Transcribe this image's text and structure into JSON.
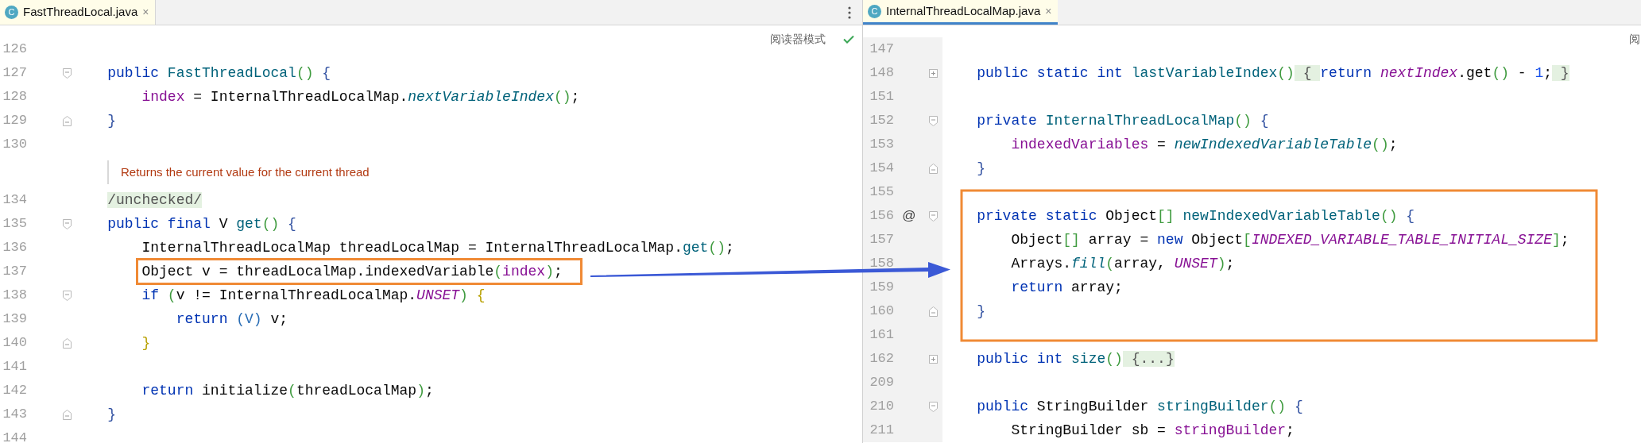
{
  "editors": [
    {
      "tab": {
        "icon_letter": "C",
        "title": "FastThreadLocal.java",
        "close": "×",
        "selected": false
      },
      "reader_mode": "阅读器模式",
      "reader_mode_ok": true,
      "lines": [
        {
          "kind": "code",
          "number": "126"
        },
        {
          "kind": "code",
          "number": "127",
          "expanded": true,
          "segments": [
            {
              "text": "    public ",
              "kind": "kw"
            },
            {
              "text": "FastThreadLocal",
              "kind": "method"
            },
            {
              "text": "()",
              "kind": "paren"
            },
            {
              "text": " {",
              "kind": "brace1"
            }
          ]
        },
        {
          "kind": "code",
          "number": "128",
          "segments": [
            {
              "text": "        index",
              "kind": "field"
            },
            {
              "text": " = InternalThreadLocalMap.",
              "kind": "plain"
            },
            {
              "text": "nextVariableIndex",
              "kind": "smethod"
            },
            {
              "text": "()",
              "kind": "paren"
            },
            {
              "text": ";",
              "kind": "plain"
            }
          ]
        },
        {
          "kind": "code",
          "number": "129",
          "expanded": true,
          "block_end": true,
          "segments": [
            {
              "text": "    }",
              "kind": "brace1"
            }
          ]
        },
        {
          "kind": "code",
          "number": "130"
        },
        {
          "kind": "doc",
          "text": "Returns the current value for the current thread"
        },
        {
          "kind": "code",
          "number": "134",
          "segments": [
            {
              "text": "    /unchecked/",
              "kind": "folded"
            }
          ]
        },
        {
          "kind": "code",
          "number": "135",
          "expanded": true,
          "segments": [
            {
              "text": "    public final ",
              "kind": "kw"
            },
            {
              "text": "V ",
              "kind": "plain"
            },
            {
              "text": "get",
              "kind": "method"
            },
            {
              "text": "()",
              "kind": "paren"
            },
            {
              "text": " {",
              "kind": "brace1"
            }
          ]
        },
        {
          "kind": "code",
          "number": "136",
          "segments": [
            {
              "text": "        InternalThreadLocalMap threadLocalMap = InternalThreadLocalMap.",
              "kind": "plain"
            },
            {
              "text": "get",
              "kind": "method"
            },
            {
              "text": "()",
              "kind": "paren"
            },
            {
              "text": ";",
              "kind": "plain"
            }
          ]
        },
        {
          "kind": "code",
          "number": "137",
          "highlighted": true,
          "segments": [
            {
              "text": "        Object v = threadLocalMap.indexedVariable",
              "kind": "plain"
            },
            {
              "text": "(",
              "kind": "paren"
            },
            {
              "text": "index",
              "kind": "field"
            },
            {
              "text": ")",
              "kind": "paren"
            },
            {
              "text": ";",
              "kind": "plain"
            }
          ]
        },
        {
          "kind": "code",
          "number": "138",
          "expanded": true,
          "segments": [
            {
              "text": "        if ",
              "kind": "kw"
            },
            {
              "text": "(",
              "kind": "paren"
            },
            {
              "text": "v != InternalThreadLocalMap.",
              "kind": "plain"
            },
            {
              "text": "UNSET",
              "kind": "sfield"
            },
            {
              "text": ")",
              "kind": "paren"
            },
            {
              "text": " {",
              "kind": "brace2"
            }
          ]
        },
        {
          "kind": "code",
          "number": "139",
          "segments": [
            {
              "text": "            return ",
              "kind": "kw"
            },
            {
              "text": "(V)",
              "kind": "cast"
            },
            {
              "text": " v;",
              "kind": "plain"
            }
          ]
        },
        {
          "kind": "code",
          "number": "140",
          "expanded": true,
          "block_end": true,
          "segments": [
            {
              "text": "        }",
              "kind": "brace2"
            }
          ]
        },
        {
          "kind": "code",
          "number": "141"
        },
        {
          "kind": "code",
          "number": "142",
          "segments": [
            {
              "text": "        return ",
              "kind": "kw"
            },
            {
              "text": "initialize",
              "kind": "plain"
            },
            {
              "text": "(",
              "kind": "paren"
            },
            {
              "text": "threadLocalMap",
              "kind": "plain"
            },
            {
              "text": ")",
              "kind": "paren"
            },
            {
              "text": ";",
              "kind": "plain"
            }
          ]
        },
        {
          "kind": "code",
          "number": "143",
          "expanded": true,
          "block_end": true,
          "segments": [
            {
              "text": "    }",
              "kind": "brace1"
            }
          ]
        },
        {
          "kind": "code",
          "number": "144"
        }
      ]
    },
    {
      "tab": {
        "icon_letter": "C",
        "title": "InternalThreadLocalMap.java",
        "close": "×",
        "selected": true
      },
      "reader_mode": "阅",
      "lines": [
        {
          "kind": "code",
          "number": "147"
        },
        {
          "kind": "code",
          "number": "148",
          "expanded": false,
          "segments": [
            {
              "text": "    public static int ",
              "kind": "kw"
            },
            {
              "text": "lastVariableIndex",
              "kind": "method"
            },
            {
              "text": "()",
              "kind": "paren"
            },
            {
              "text": " { ",
              "kind": "folded"
            },
            {
              "text": "return ",
              "kind": "kw"
            },
            {
              "text": "nextIndex",
              "kind": "sfield"
            },
            {
              "text": ".get",
              "kind": "plain"
            },
            {
              "text": "()",
              "kind": "paren"
            },
            {
              "text": " - ",
              "kind": "plain"
            },
            {
              "text": "1",
              "kind": "num"
            },
            {
              "text": ";",
              "kind": "plain"
            },
            {
              "text": " }",
              "kind": "folded"
            }
          ]
        },
        {
          "kind": "code",
          "number": "151"
        },
        {
          "kind": "code",
          "number": "152",
          "expanded": true,
          "segments": [
            {
              "text": "    private ",
              "kind": "kw"
            },
            {
              "text": "InternalThreadLocalMap",
              "kind": "method"
            },
            {
              "text": "()",
              "kind": "paren"
            },
            {
              "text": " {",
              "kind": "brace1"
            }
          ]
        },
        {
          "kind": "code",
          "number": "153",
          "segments": [
            {
              "text": "        indexedVariables",
              "kind": "field"
            },
            {
              "text": " = ",
              "kind": "plain"
            },
            {
              "text": "newIndexedVariableTable",
              "kind": "smethod"
            },
            {
              "text": "()",
              "kind": "paren"
            },
            {
              "text": ";",
              "kind": "plain"
            }
          ]
        },
        {
          "kind": "code",
          "number": "154",
          "expanded": true,
          "block_end": true,
          "segments": [
            {
              "text": "    }",
              "kind": "brace1"
            }
          ]
        },
        {
          "kind": "code",
          "number": "155"
        },
        {
          "kind": "code",
          "number": "156",
          "mark": "@",
          "expanded": true,
          "segments": [
            {
              "text": "    private static ",
              "kind": "kw"
            },
            {
              "text": "Object",
              "kind": "plain"
            },
            {
              "text": "[]",
              "kind": "paren"
            },
            {
              "text": " newIndexedVariableTable",
              "kind": "method"
            },
            {
              "text": "()",
              "kind": "paren"
            },
            {
              "text": " {",
              "kind": "brace1"
            }
          ]
        },
        {
          "kind": "code",
          "number": "157",
          "segments": [
            {
              "text": "        Object",
              "kind": "plain"
            },
            {
              "text": "[]",
              "kind": "paren"
            },
            {
              "text": " array = ",
              "kind": "plain"
            },
            {
              "text": "new ",
              "kind": "kw"
            },
            {
              "text": "Object",
              "kind": "plain"
            },
            {
              "text": "[",
              "kind": "paren"
            },
            {
              "text": "INDEXED_VARIABLE_TABLE_INITIAL_SIZE",
              "kind": "sfield"
            },
            {
              "text": "]",
              "kind": "paren"
            },
            {
              "text": ";",
              "kind": "plain"
            }
          ]
        },
        {
          "kind": "code",
          "number": "158",
          "segments": [
            {
              "text": "        Arrays.",
              "kind": "plain"
            },
            {
              "text": "fill",
              "kind": "smethod"
            },
            {
              "text": "(",
              "kind": "paren"
            },
            {
              "text": "array, ",
              "kind": "plain"
            },
            {
              "text": "UNSET",
              "kind": "sfield"
            },
            {
              "text": ")",
              "kind": "paren"
            },
            {
              "text": ";",
              "kind": "plain"
            }
          ]
        },
        {
          "kind": "code",
          "number": "159",
          "segments": [
            {
              "text": "        return",
              "kind": "kw"
            },
            {
              "text": " array;",
              "kind": "plain"
            }
          ]
        },
        {
          "kind": "code",
          "number": "160",
          "expanded": true,
          "block_end": true,
          "segments": [
            {
              "text": "    }",
              "kind": "brace1"
            }
          ]
        },
        {
          "kind": "code",
          "number": "161"
        },
        {
          "kind": "code",
          "number": "162",
          "expanded": false,
          "segments": [
            {
              "text": "    public int ",
              "kind": "kw"
            },
            {
              "text": "size",
              "kind": "method"
            },
            {
              "text": "()",
              "kind": "paren"
            },
            {
              "text": " {...}",
              "kind": "folded"
            }
          ]
        },
        {
          "kind": "code",
          "number": "209"
        },
        {
          "kind": "code",
          "number": "210",
          "expanded": true,
          "segments": [
            {
              "text": "    public ",
              "kind": "kw"
            },
            {
              "text": "StringBuilder ",
              "kind": "plain"
            },
            {
              "text": "stringBuilder",
              "kind": "method"
            },
            {
              "text": "()",
              "kind": "paren"
            },
            {
              "text": " {",
              "kind": "brace1"
            }
          ]
        },
        {
          "kind": "code",
          "number": "211",
          "segments": [
            {
              "text": "        StringBuilder sb = ",
              "kind": "plain"
            },
            {
              "text": "stringBuilder",
              "kind": "field"
            },
            {
              "text": ";",
              "kind": "plain"
            }
          ]
        }
      ]
    }
  ]
}
